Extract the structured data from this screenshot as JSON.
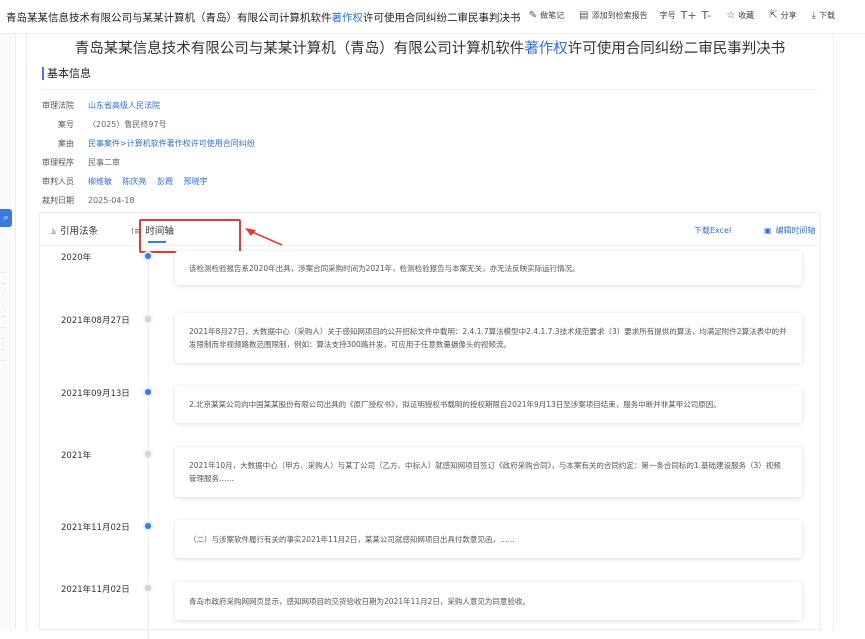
{
  "header": {
    "title_prefix": "青岛某某信息技术有限公司与某某计算机（青岛）有限公司计算机软件",
    "title_highlight": "著作权",
    "title_suffix": "许可使用合同纠纷二审民事判决书",
    "actions": {
      "notes": "做笔记",
      "add_report": "添加到检索报告",
      "font_size": "字号",
      "font_up": "T+",
      "font_down": "T-",
      "favorite": "收藏",
      "share": "分享",
      "download": "下载"
    }
  },
  "document": {
    "title_prefix": "青岛某某信息技术有限公司与某某计算机（青岛）有限公司计算机软件",
    "title_highlight": "著作权",
    "title_suffix": "许可使用合同纠纷二审民事判决书"
  },
  "basic_info": {
    "heading": "基本信息",
    "rows": [
      {
        "label": "审理法院",
        "value": "山东省高级人民法院"
      },
      {
        "label": "案号",
        "value": "（2025）鲁民终97号"
      },
      {
        "label": "案由",
        "value": "民事案件>计算机软件著作权许可使用合同纠纷"
      },
      {
        "label": "审理程序",
        "value": "民事二审"
      },
      {
        "label": "审判人员",
        "values": [
          "柳维敏",
          "陈庆亮",
          "彭霞",
          "邢晓宇"
        ]
      },
      {
        "label": "裁判日期",
        "value": "2025-04-18"
      }
    ]
  },
  "tabs": {
    "citation": "引用法条",
    "timeline": "时间轴",
    "download_excel": "下载Excel",
    "edit_timeline": "编辑时间轴"
  },
  "timeline": [
    {
      "date": "2020年",
      "active": true,
      "text": "该检测检验报告系2020年出具，涉案合同采购时间为2021年，检测检验报告与本案无关，亦无法反映实际运行情况。"
    },
    {
      "date": "2021年08月27日",
      "active": false,
      "text": "2021年8月27日，大数据中心（采购人）关于感知网项目的公开招标文件中载明：2.4.1.7算法模型中2.4.1.7.3技术规范要求（3）要求所有提供的算法，均满足附件2算法表中的并发限制而非视频路数范围限制，例如：算法支持300路并发，可应用于任意数量摄像头的视频流。"
    },
    {
      "date": "2021年09月13日",
      "active": true,
      "text": "2.北京某某公司向中国某某股份有限公司出具的《原厂授权书》，拟证明授权书载明的授权期限自2021年9月13日至涉案项目结束，服务中断并非某甲公司原因。"
    },
    {
      "date": "2021年",
      "active": false,
      "text": "2021年10月，大数据中心（甲方、采购人）与某丁公司（乙方、中标人）就感知网项目签订《政府采购合同》，与本案有关的合同约定：第一条合同标的1.基础建设服务（3）视频管理服务……"
    },
    {
      "date": "2021年11月02日",
      "active": true,
      "text": "（二）与涉案软件履行有关的事实2021年11月2日，某某公司就感知网项目出具付款意见函，……"
    },
    {
      "date": "2021年11月02日",
      "active": false,
      "text": "青岛市政府采购网网页显示，感知网项目的交货验收日期为2021年11月2日，采购人意见为同意验收。"
    }
  ]
}
